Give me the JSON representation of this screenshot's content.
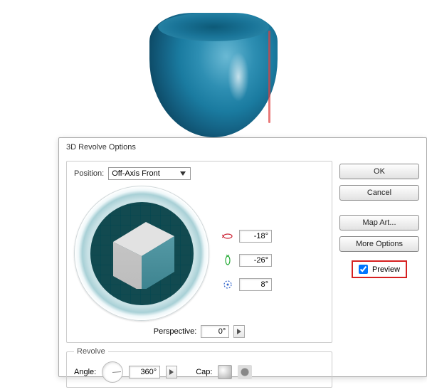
{
  "dialog": {
    "title": "3D Revolve Options",
    "position": {
      "label": "Position:",
      "value": "Off-Axis Front"
    },
    "rotation": {
      "x": "-18°",
      "y": "-26°",
      "z": "8°"
    },
    "perspective": {
      "label": "Perspective:",
      "value": "0°"
    },
    "revolve": {
      "legend": "Revolve",
      "angle_label": "Angle:",
      "angle_value": "360°",
      "cap_label": "Cap:"
    },
    "buttons": {
      "ok": "OK",
      "cancel": "Cancel",
      "map_art": "Map Art...",
      "more_options": "More Options"
    },
    "preview": {
      "label": "Preview",
      "checked": true
    }
  }
}
